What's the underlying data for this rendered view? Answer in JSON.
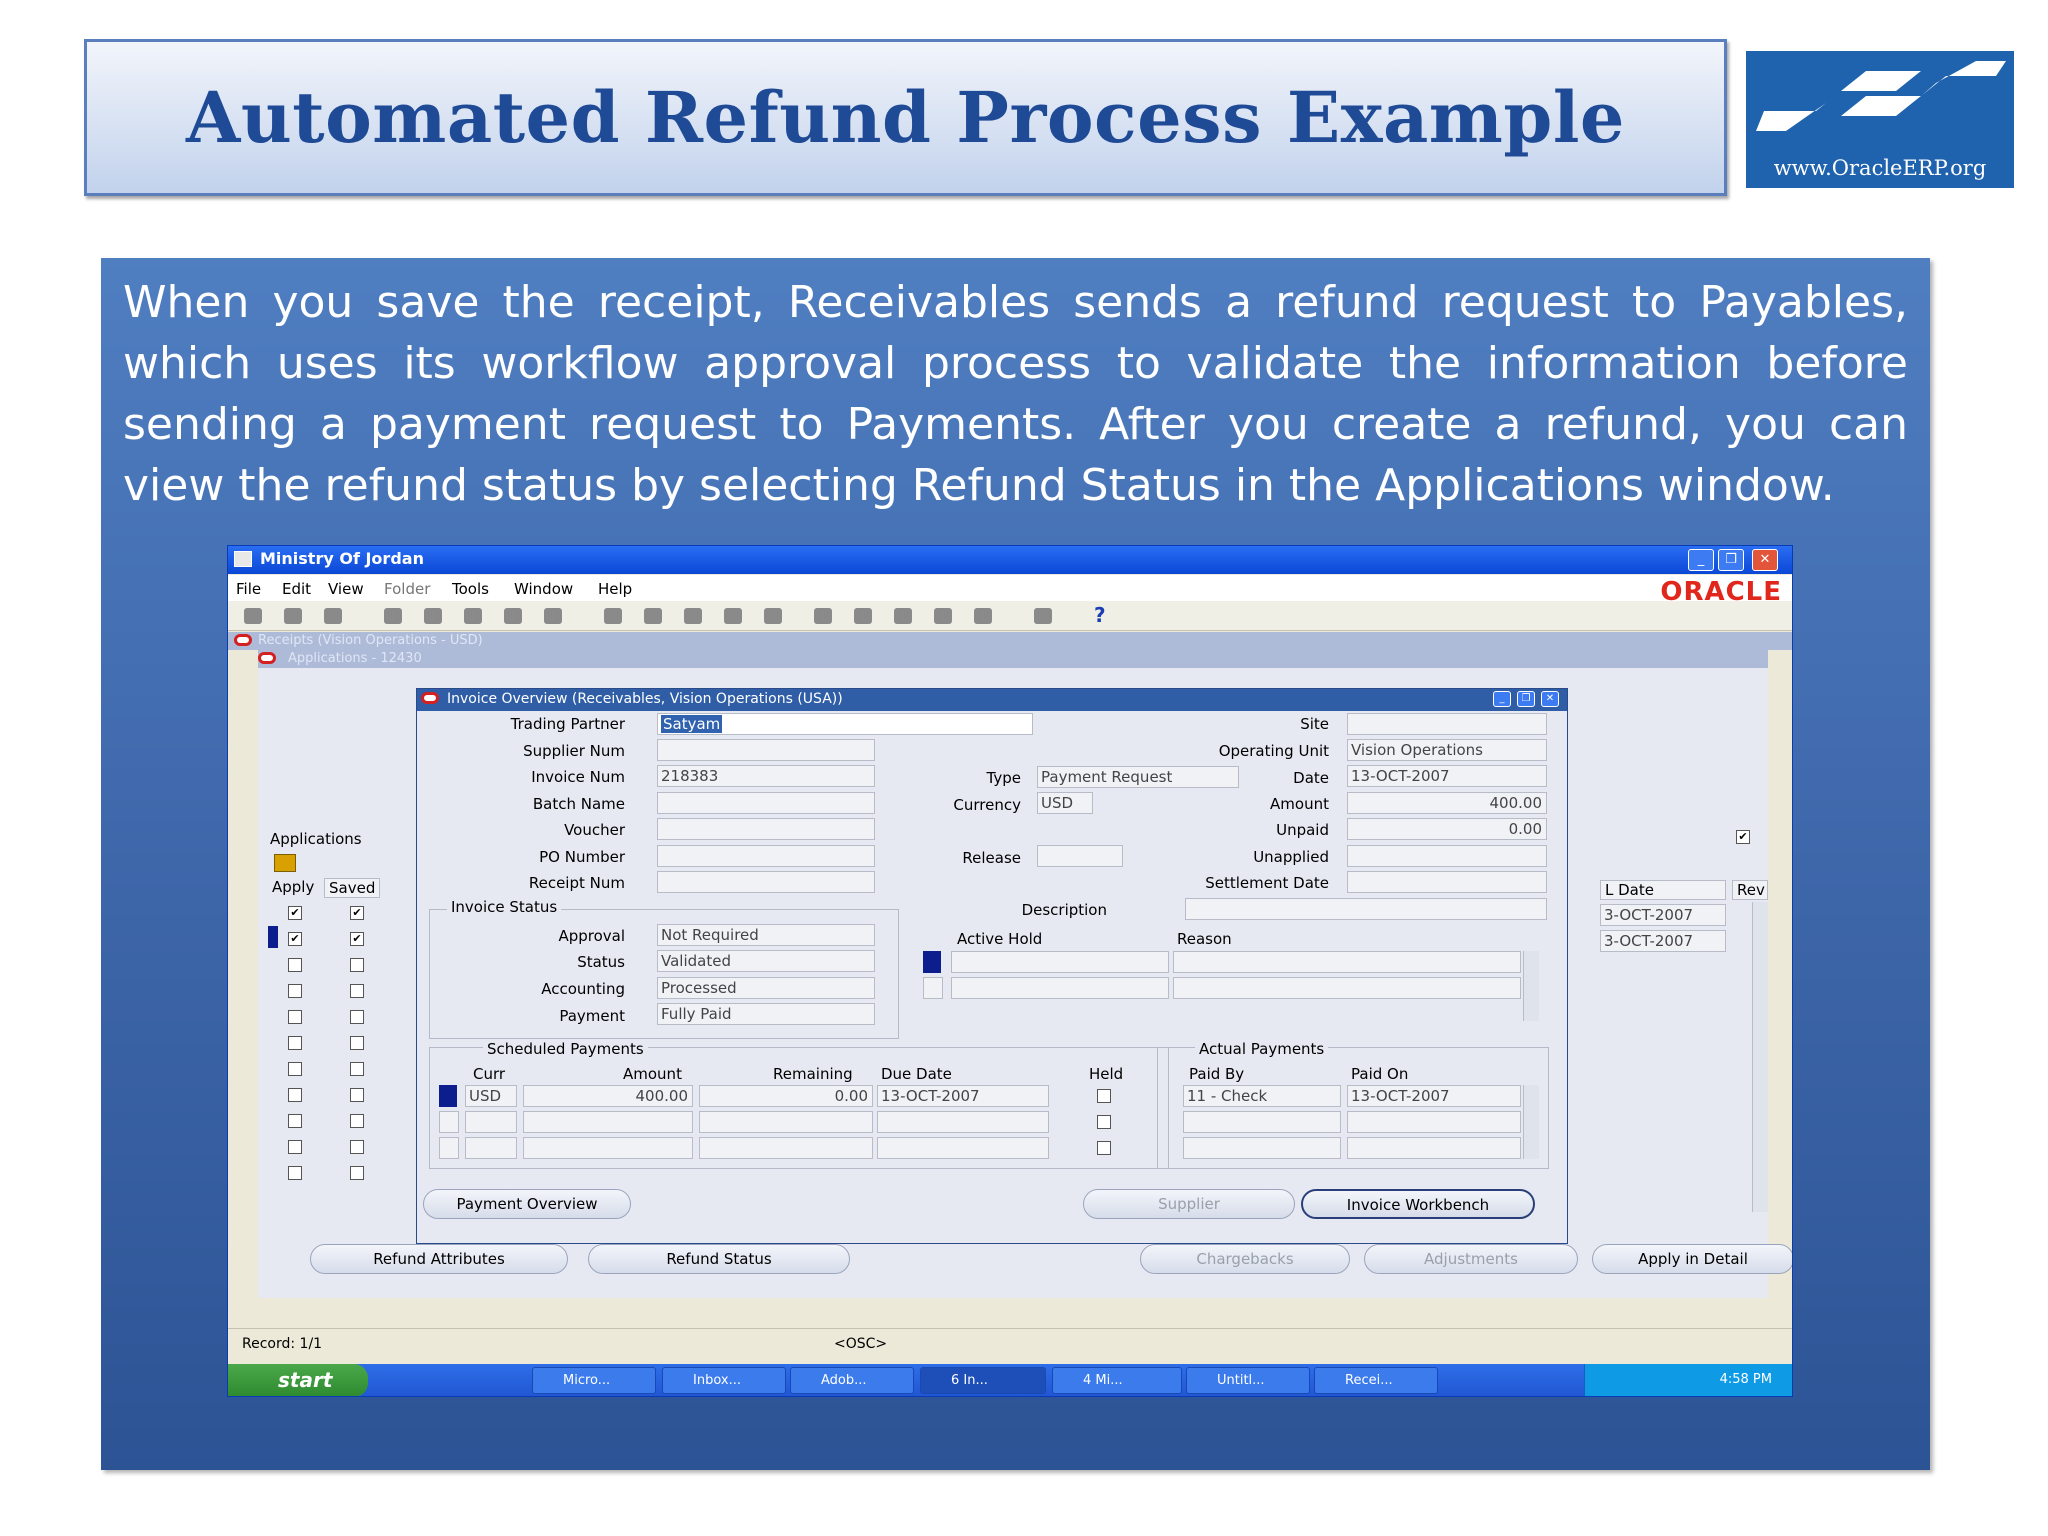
{
  "slide": {
    "title": "Automated Refund Process Example",
    "logo_text": "www.OracleERP.org",
    "paragraph": "When you save the receipt, Receivables sends a refund request to Payables, which uses its workflow approval process to validate the information before sending a payment request to Payments. After you create a refund, you can view the refund status by selecting Refund Status in the Applications window."
  },
  "window": {
    "title": "Ministry Of Jordan",
    "menu": [
      "File",
      "Edit",
      "View",
      "Folder",
      "Tools",
      "Window",
      "Help"
    ],
    "brand": "ORACLE",
    "bg_window_1": "Receipts (Vision Operations - USD)",
    "bg_window_2": "Applications - 12430"
  },
  "applications": {
    "label": "Applications",
    "col_apply": "Apply",
    "col_saved": "Saved",
    "col_gl_date": "L Date",
    "col_rev": "Rev",
    "gl_dates": [
      "3-OCT-2007",
      "3-OCT-2007"
    ],
    "buttons": {
      "refund_attributes": "Refund Attributes",
      "refund_status": "Refund Status",
      "chargebacks": "Chargebacks",
      "adjustments": "Adjustments",
      "apply_in_detail": "Apply in Detail"
    }
  },
  "invoice": {
    "title": "Invoice Overview (Receivables, Vision Operations (USA))",
    "labels": {
      "trading_partner": "Trading Partner",
      "supplier_num": "Supplier Num",
      "invoice_num": "Invoice Num",
      "batch_name": "Batch Name",
      "voucher": "Voucher",
      "po_number": "PO Number",
      "receipt_num": "Receipt Num",
      "type": "Type",
      "currency": "Currency",
      "release": "Release",
      "site": "Site",
      "operating_unit": "Operating Unit",
      "date": "Date",
      "amount": "Amount",
      "unpaid": "Unpaid",
      "unapplied": "Unapplied",
      "settlement_date": "Settlement Date",
      "description": "Description",
      "invoice_status": "Invoice Status",
      "approval": "Approval",
      "status": "Status",
      "accounting": "Accounting",
      "payment": "Payment",
      "active_hold": "Active Hold",
      "reason": "Reason",
      "scheduled_payments": "Scheduled Payments",
      "curr": "Curr",
      "sched_amount": "Amount",
      "remaining": "Remaining",
      "due_date": "Due Date",
      "held": "Held",
      "actual_payments": "Actual Payments",
      "paid_by": "Paid By",
      "paid_on": "Paid On"
    },
    "values": {
      "trading_partner": "Satyam",
      "invoice_num": "218383",
      "type": "Payment Request",
      "currency": "USD",
      "operating_unit": "Vision Operations",
      "date": "13-OCT-2007",
      "amount": "400.00",
      "unpaid": "0.00",
      "approval": "Not Required",
      "status": "Validated",
      "accounting": "Processed",
      "payment": "Fully Paid"
    },
    "scheduled_row": {
      "curr": "USD",
      "amount": "400.00",
      "remaining": "0.00",
      "due_date": "13-OCT-2007"
    },
    "actual_row": {
      "paid_by": "11 - Check",
      "paid_on": "13-OCT-2007"
    },
    "buttons": {
      "payment_overview": "Payment Overview",
      "supplier": "Supplier",
      "invoice_workbench": "Invoice Workbench"
    }
  },
  "statusbar": {
    "record": "Record: 1/1",
    "osc": "<OSC>"
  },
  "taskbar": {
    "start": "start",
    "tasks": [
      "Micro...",
      "Inbox...",
      "Adob...",
      "6 In...",
      "4 Mi...",
      "Untitl...",
      "Recei..."
    ],
    "clock": "4:58 PM"
  },
  "colors": {
    "title_blue": "#1f4a96",
    "panel_blue": "#3e67aa",
    "oracle_red": "#e1261c"
  }
}
